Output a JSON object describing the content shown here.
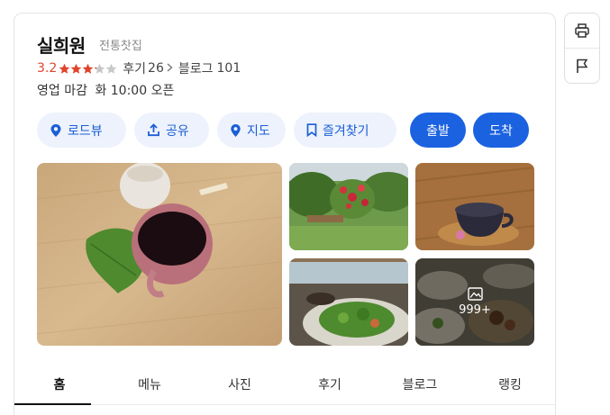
{
  "place": {
    "name": "실희원",
    "category": "전통찻집",
    "rating": "3.2",
    "rating_value": 3.2,
    "rating_max": 5,
    "reviews_label": "후기",
    "reviews_count": "26",
    "blog_label": "블로그",
    "blog_count": "101",
    "status": "영업 마감",
    "next_open": "화 10:00 오픈"
  },
  "actions": [
    {
      "label": "로드뷰",
      "icon": "roadview-pin-icon"
    },
    {
      "label": "공유",
      "icon": "share-icon"
    },
    {
      "label": "지도",
      "icon": "map-pin-icon"
    },
    {
      "label": "즐겨찾기",
      "icon": "bookmark-icon"
    }
  ],
  "directions": {
    "start_label": "출발",
    "arrive_label": "도착"
  },
  "photos": {
    "more_count": "999+",
    "more_icon": "gallery-icon"
  },
  "tabs": [
    {
      "label": "홈",
      "active": true
    },
    {
      "label": "메뉴",
      "active": false
    },
    {
      "label": "사진",
      "active": false
    },
    {
      "label": "후기",
      "active": false
    },
    {
      "label": "블로그",
      "active": false
    },
    {
      "label": "랭킹",
      "active": false
    }
  ],
  "side_tools": [
    {
      "icon": "print-icon"
    },
    {
      "icon": "flag-icon"
    }
  ],
  "colors": {
    "accent": "#1b62e0",
    "pill_bg": "#edf2fc",
    "rating": "#e0442d",
    "star_empty": "#c8c8c8"
  }
}
